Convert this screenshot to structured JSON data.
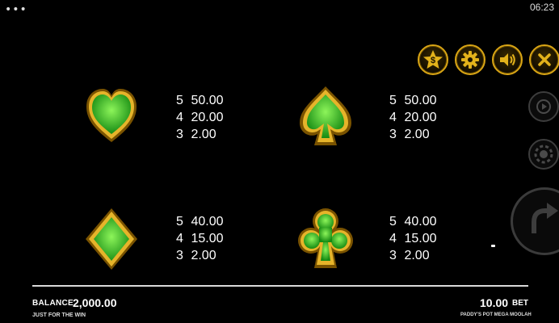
{
  "status_bar": {
    "menu_dots": "•••",
    "time": "06:23"
  },
  "controls": {
    "buttons": [
      "favorite-star",
      "settings",
      "sound",
      "close"
    ],
    "side_buttons": [
      "autoplay",
      "bet-chip"
    ],
    "spin": "spin"
  },
  "paytable": [
    {
      "symbol": "heart",
      "pays": [
        {
          "count": "5",
          "value": "50.00"
        },
        {
          "count": "4",
          "value": "20.00"
        },
        {
          "count": "3",
          "value": "2.00"
        }
      ]
    },
    {
      "symbol": "spade",
      "pays": [
        {
          "count": "5",
          "value": "50.00"
        },
        {
          "count": "4",
          "value": "20.00"
        },
        {
          "count": "3",
          "value": "2.00"
        }
      ]
    },
    {
      "symbol": "diamond",
      "pays": [
        {
          "count": "5",
          "value": "40.00"
        },
        {
          "count": "4",
          "value": "15.00"
        },
        {
          "count": "3",
          "value": "2.00"
        }
      ]
    },
    {
      "symbol": "club",
      "pays": [
        {
          "count": "5",
          "value": "40.00"
        },
        {
          "count": "4",
          "value": "15.00"
        },
        {
          "count": "3",
          "value": "2.00"
        }
      ]
    }
  ],
  "footer": {
    "balance_label": "BALANCE",
    "balance_value": "2,000.00",
    "tagline": "JUST FOR THE WIN",
    "bet_value": "10.00",
    "bet_label": "BET",
    "game_name": "PADDY'S POT MEGA MOOLAH"
  },
  "colors": {
    "gold": "#d9a515",
    "green": "#2fc52a",
    "background": "#000000"
  }
}
